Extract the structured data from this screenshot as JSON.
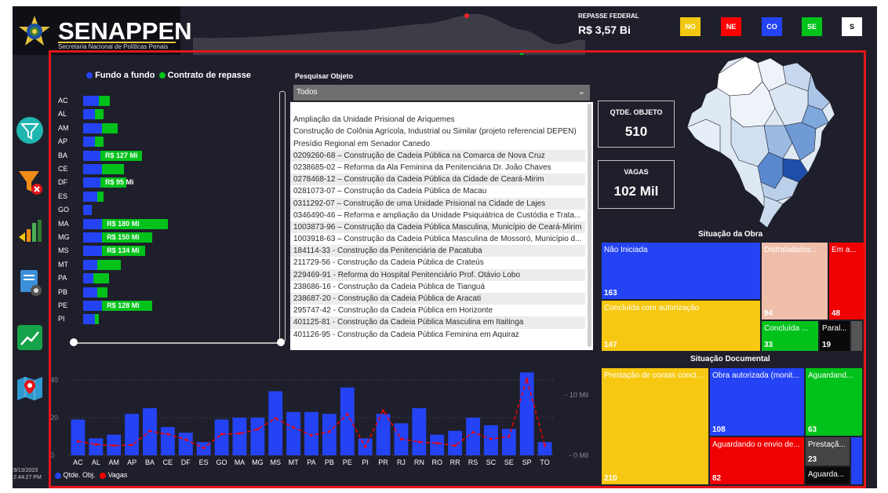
{
  "header": {
    "logo_title": "SENAPPEN",
    "logo_subtitle": "Secretaria Nacional de Políticas Penais",
    "repasse_label": "REPASSE FEDERAL",
    "repasse_value": "R$ 3,57 Bi",
    "regions": [
      {
        "label": "NO",
        "color": "#f2c811",
        "text_color": "#ffffff"
      },
      {
        "label": "NE",
        "color": "#ff0000",
        "text_color": "#ffffff"
      },
      {
        "label": "CO",
        "color": "#2443f5",
        "text_color": "#ffffff"
      },
      {
        "label": "SE",
        "color": "#00c21a",
        "text_color": "#ffffff"
      },
      {
        "label": "S",
        "color": "#ffffff",
        "text_color": "#000000"
      }
    ]
  },
  "sidebar": {
    "icons": [
      "filter-icon",
      "clear-filter-icon",
      "sound-chart-icon",
      "document-settings-icon",
      "trend-chart-icon",
      "map-icon"
    ],
    "date": "9/13/2023",
    "time": "2:44:27 PM"
  },
  "legend_top": {
    "fundo": "Fundo a fundo",
    "contrato": "Contrato de repasse",
    "fundo_color": "#2443f5",
    "contrato_color": "#00c21a"
  },
  "search": {
    "label": "Pesquisar Objeto",
    "dropdown_value": "Todos",
    "items": [
      "",
      "Ampliação da Unidade Prisional de Ariquemes",
      "Construção de Colônia Agrícola, Industrial ou Similar (projeto referencial DEPEN)",
      "Presídio Regional em Senador Canedo",
      "0209260-68 – Construção de Cadeia Pública na Comarca de Nova Cruz",
      "0238685-02 – Reforma da Ala Feminina da Penitenciária Dr. João Chaves",
      "0278468-12 – Construção da Cadeia Pública da Cidade de Ceará-Mirim",
      "0281073-07 – Construção da Cadeia Pública de Macau",
      "0311292-07 – Construção de uma Unidade Prisional na Cidade de Lajes",
      "0346490-46 – Reforma e ampliação da Unidade Psiquiátrica de Custódia e Trata...",
      "1003873-96 – Construção da Cadeia Pública Masculina, Município de Ceará-Mirim",
      "1003918-63 – Construção da Cadeia Pública Masculina de Mossoró, Município d...",
      "184114-33 - Construção da Penitenciária de Pacatuba",
      "211729-56 - Construção da Cadeia Pública de Crateús",
      "229469-91 - Reforma do Hospital Penitenciário Prof. Otávio Lobo",
      "238686-16 - Construção da Cadeia Pública de Tianguá",
      "238687-20 - Construção da Cadeia Pública de Aracati",
      "295747-42 - Construção da Cadeia Pública em Horizonte",
      "401125-81 - Construção da Cadeia Pública Masculina em Itaitinga",
      "401126-95 - Construção da Cadeia Pública Feminina em Aquiraz"
    ]
  },
  "kpis": {
    "qtde_label": "QTDE. OBJETO",
    "qtde_value": "510",
    "vagas_label": "VAGAS",
    "vagas_value": "102 Mil"
  },
  "situacao_obra": {
    "title": "Situação da Obra",
    "tiles": [
      {
        "label": "Não Iniciada",
        "value": "163",
        "color": "#2443f5"
      },
      {
        "label": "Concluída com autorização",
        "value": "147",
        "color": "#f7c811"
      },
      {
        "label": "Distratada/ca...",
        "value": "94",
        "color": "#efbfab"
      },
      {
        "label": "Em a...",
        "value": "48",
        "color": "#f00000"
      },
      {
        "label": "Concluída ...",
        "value": "33",
        "color": "#00c21a"
      },
      {
        "label": "Paral...",
        "value": "19",
        "color": "#0a0a0a"
      },
      {
        "label": "",
        "value": "",
        "color": "#555555"
      }
    ]
  },
  "situacao_doc": {
    "title": "Situação Documental",
    "tiles": [
      {
        "label": "Prestação de contas concl...",
        "value": "210",
        "color": "#f7c811"
      },
      {
        "label": "Obra autorizada (monit...",
        "value": "108",
        "color": "#2443f5"
      },
      {
        "label": "Aguardando o envio de...",
        "value": "82",
        "color": "#f00000"
      },
      {
        "label": "Aguardand...",
        "value": "63",
        "color": "#00c21a"
      },
      {
        "label": "Prestaçã...",
        "value": "23",
        "color": "#444444"
      },
      {
        "label": "Aguarda...",
        "value": "",
        "color": "#0a0a0a"
      },
      {
        "label": "",
        "value": "",
        "color": "#2443f5"
      }
    ]
  },
  "bottom_legend": {
    "qtde": "Qtde. Obj.",
    "vagas": "Vagas",
    "qtde_color": "#2443f5",
    "vagas_color": "#f00000"
  },
  "chart_data": [
    {
      "type": "bar",
      "orientation": "horizontal",
      "stacked": true,
      "categories": [
        "AC",
        "AL",
        "AM",
        "AP",
        "BA",
        "CE",
        "DF",
        "ES",
        "GO",
        "MA",
        "MG",
        "MS",
        "MT",
        "PA",
        "PB",
        "PE",
        "PI"
      ],
      "series": [
        {
          "name": "Fundo a fundo",
          "color": "#2443f5",
          "values": [
            18,
            14,
            22,
            14,
            20,
            22,
            20,
            16,
            10,
            22,
            22,
            22,
            16,
            12,
            16,
            22,
            14
          ]
        },
        {
          "name": "Contrato de repasse",
          "color": "#00c21a",
          "values": [
            13,
            10,
            18,
            10,
            48,
            25,
            30,
            8,
            0,
            76,
            58,
            50,
            28,
            18,
            12,
            58,
            4
          ]
        }
      ],
      "data_labels": [
        "",
        "",
        "",
        "",
        "R$ 127 Mi",
        "",
        "R$ 95 Mi",
        "",
        "",
        "R$ 180 Mi",
        "R$ 150 Mi",
        "R$ 134 Mi",
        "",
        "",
        "",
        "R$ 128 Mi",
        ""
      ]
    },
    {
      "type": "bar",
      "categories": [
        "AC",
        "AL",
        "AM",
        "AP",
        "BA",
        "CE",
        "DF",
        "ES",
        "GO",
        "MA",
        "MG",
        "MS",
        "MT",
        "PA",
        "PB",
        "PE",
        "PI",
        "PR",
        "RJ",
        "RN",
        "RO",
        "RR",
        "RS",
        "SC",
        "SE",
        "SP",
        "TO"
      ],
      "series": [
        {
          "name": "Qtde. Obj.",
          "type": "bar",
          "color": "#2443f5",
          "axis": "left",
          "values": [
            19,
            9,
            11,
            22,
            25,
            15,
            12,
            7,
            19,
            20,
            20,
            34,
            23,
            23,
            22,
            36,
            9,
            22,
            17,
            25,
            11,
            13,
            20,
            16,
            14,
            44,
            7
          ]
        },
        {
          "name": "Vagas",
          "type": "line",
          "color": "#f00000",
          "axis": "right",
          "values": [
            2.3,
            1.8,
            1.6,
            1.7,
            4.0,
            3.5,
            2.6,
            1.2,
            3.5,
            3.6,
            4.3,
            6.1,
            4.6,
            3.3,
            3.9,
            6.8,
            1.4,
            7.4,
            2.7,
            2.2,
            2.0,
            1.6,
            3.8,
            2.7,
            3.1,
            12.6,
            1.6
          ]
        }
      ],
      "y_left": {
        "ticks": [
          "0",
          "20",
          "40"
        ],
        "range": [
          0,
          45
        ]
      },
      "y_right": {
        "ticks": [
          "0 Mil",
          "10 Mil"
        ],
        "range": [
          0,
          14
        ]
      }
    }
  ]
}
